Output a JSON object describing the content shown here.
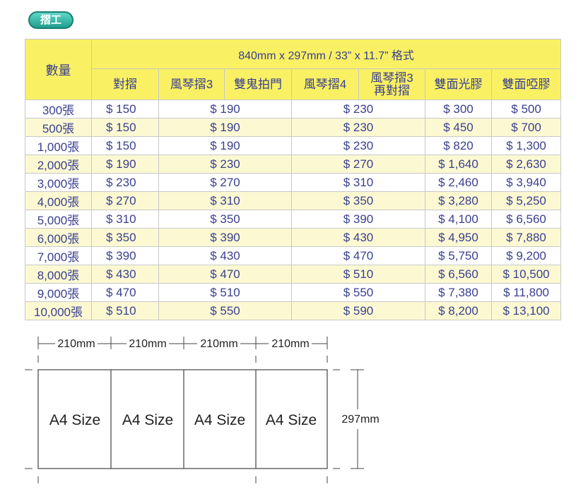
{
  "badge": {
    "label": "摺工"
  },
  "table": {
    "quantity_header": "數量",
    "format_header": "840mm x 297mm / 33” x 11.7” 格式",
    "columns": [
      {
        "id": "fold",
        "label": "對摺"
      },
      {
        "id": "accordion3",
        "label": "風琴摺3"
      },
      {
        "id": "gate",
        "label": "雙鬼拍門"
      },
      {
        "id": "accordion4",
        "label": "風琴摺4"
      },
      {
        "id": "accordion3_refold",
        "label": "風琴摺3\n再對摺"
      },
      {
        "id": "gloss",
        "label": "雙面光膠"
      },
      {
        "id": "matte",
        "label": "雙面啞膠"
      }
    ],
    "rows": [
      {
        "qty": "300張",
        "fold": "$ 150",
        "group2": "$ 190",
        "group3": "$ 230",
        "gloss": "$ 300",
        "matte": "$ 500"
      },
      {
        "qty": "500張",
        "fold": "$ 150",
        "group2": "$ 190",
        "group3": "$ 230",
        "gloss": "$ 450",
        "matte": "$ 700"
      },
      {
        "qty": "1,000張",
        "fold": "$ 150",
        "group2": "$ 190",
        "group3": "$ 230",
        "gloss": "$ 820",
        "matte": "$ 1,300"
      },
      {
        "qty": "2,000張",
        "fold": "$ 190",
        "group2": "$ 230",
        "group3": "$ 270",
        "gloss": "$ 1,640",
        "matte": "$ 2,630"
      },
      {
        "qty": "3,000張",
        "fold": "$ 230",
        "group2": "$ 270",
        "group3": "$ 310",
        "gloss": "$ 2,460",
        "matte": "$ 3,940"
      },
      {
        "qty": "4,000張",
        "fold": "$ 270",
        "group2": "$ 310",
        "group3": "$ 350",
        "gloss": "$ 3,280",
        "matte": "$ 5,250"
      },
      {
        "qty": "5,000張",
        "fold": "$ 310",
        "group2": "$ 350",
        "group3": "$ 390",
        "gloss": "$ 4,100",
        "matte": "$ 6,560"
      },
      {
        "qty": "6,000張",
        "fold": "$ 350",
        "group2": "$ 390",
        "group3": "$ 430",
        "gloss": "$ 4,950",
        "matte": "$ 7,880"
      },
      {
        "qty": "7,000張",
        "fold": "$ 390",
        "group2": "$ 430",
        "group3": "$ 470",
        "gloss": "$ 5,750",
        "matte": "$ 9,200"
      },
      {
        "qty": "8,000張",
        "fold": "$ 430",
        "group2": "$ 470",
        "group3": "$ 510",
        "gloss": "$ 6,560",
        "matte": "$ 10,500"
      },
      {
        "qty": "9,000張",
        "fold": "$ 470",
        "group2": "$ 510",
        "group3": "$ 550",
        "gloss": "$ 7,380",
        "matte": "$ 11,800"
      },
      {
        "qty": "10,000張",
        "fold": "$ 510",
        "group2": "$ 550",
        "group3": "$ 590",
        "gloss": "$ 8,200",
        "matte": "$ 13,100"
      }
    ]
  },
  "diagram": {
    "panel_widths": [
      "210mm",
      "210mm",
      "210mm",
      "210mm"
    ],
    "panel_labels": [
      "A4 Size",
      "A4 Size",
      "A4 Size",
      "A4 Size"
    ],
    "height_label": "297mm"
  },
  "colors": {
    "header_yellow": "#f9f163",
    "row_alt": "#fcf9d2",
    "text_blue": "#3a3f8f",
    "badge_green": "#1f9f8f"
  }
}
